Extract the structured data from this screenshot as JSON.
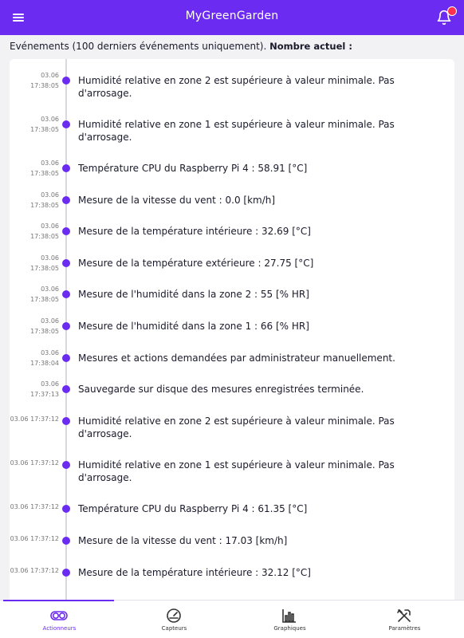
{
  "app": {
    "title": "MyGreenGarden"
  },
  "colors": {
    "accent": "#6b2bf0",
    "badge": "#ff3050"
  },
  "header": {
    "text": "Evénements (100 derniers événements uniquement).",
    "count_label": "Nombre actuel :"
  },
  "events": [
    {
      "time": "03.06\n17:38:05",
      "text": "Humidité relative en zone 2 est supérieure à valeur minimale. Pas d'arrosage."
    },
    {
      "time": "03.06\n17:38:05",
      "text": "Humidité relative en zone 1 est supérieure à valeur minimale. Pas d'arrosage."
    },
    {
      "time": "03.06\n17:38:05",
      "text": "Température CPU du Raspberry Pi 4 : 58.91 [°C]"
    },
    {
      "time": "03.06\n17:38:05",
      "text": "Mesure de la vitesse du vent : 0.0 [km/h]"
    },
    {
      "time": "03.06\n17:38:05",
      "text": "Mesure de la température intérieure : 32.69 [°C]"
    },
    {
      "time": "03.06\n17:38:05",
      "text": "Mesure de la température extérieure : 27.75 [°C]"
    },
    {
      "time": "03.06\n17:38:05",
      "text": "Mesure de l'humidité dans la zone 2 : 55 [% HR]"
    },
    {
      "time": "03.06\n17:38:05",
      "text": "Mesure de l'humidité dans la zone 1 : 66 [% HR]"
    },
    {
      "time": "03.06\n17:38:04",
      "text": "Mesures et actions demandées par administrateur manuellement."
    },
    {
      "time": "03.06\n17:37:13",
      "text": "Sauvegarde sur disque des mesures enregistrées terminée."
    },
    {
      "time": "03.06 17:37:12",
      "text": "Humidité relative en zone 2 est supérieure à valeur minimale. Pas d'arrosage."
    },
    {
      "time": "03.06 17:37:12",
      "text": "Humidité relative en zone 1 est supérieure à valeur minimale. Pas d'arrosage."
    },
    {
      "time": "03.06 17:37:12",
      "text": "Température CPU du Raspberry Pi 4 : 61.35 [°C]"
    },
    {
      "time": "03.06 17:37:12",
      "text": "Mesure de la vitesse du vent : 17.03 [km/h]"
    },
    {
      "time": "03.06 17:37:12",
      "text": "Mesure de la température intérieure : 32.12 [°C]"
    }
  ],
  "nav": {
    "active": "actionneurs",
    "items": [
      {
        "id": "actionneurs",
        "label": "Actionneurs",
        "icon": "toggle-icon"
      },
      {
        "id": "capteurs",
        "label": "Capteurs",
        "icon": "gauge-icon"
      },
      {
        "id": "graphiques",
        "label": "Graphiques",
        "icon": "bar-chart-icon"
      },
      {
        "id": "parametres",
        "label": "Paramètres",
        "icon": "tools-icon"
      }
    ]
  }
}
